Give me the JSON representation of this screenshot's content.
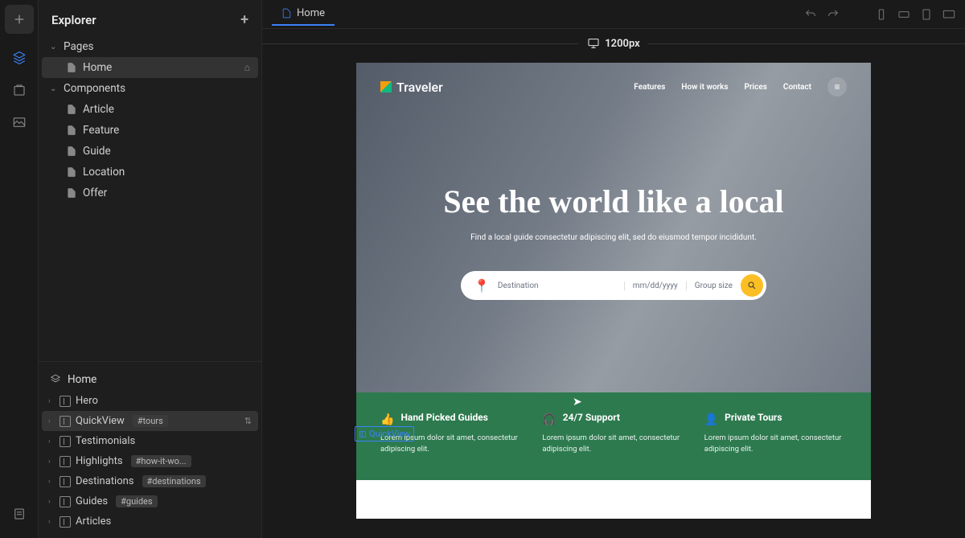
{
  "explorer": {
    "title": "Explorer",
    "sections": {
      "pages": {
        "label": "Pages",
        "items": [
          {
            "label": "Home",
            "selected": true
          }
        ]
      },
      "components": {
        "label": "Components",
        "items": [
          {
            "label": "Article"
          },
          {
            "label": "Feature"
          },
          {
            "label": "Guide"
          },
          {
            "label": "Location"
          },
          {
            "label": "Offer"
          }
        ]
      }
    }
  },
  "outline": {
    "title": "Home",
    "nodes": [
      {
        "label": "Hero"
      },
      {
        "label": "QuickView",
        "tag": "#tours",
        "selected": true,
        "reorder": true
      },
      {
        "label": "Testimonials"
      },
      {
        "label": "Highlights",
        "tag": "#how-it-wo..."
      },
      {
        "label": "Destinations",
        "tag": "#destinations"
      },
      {
        "label": "Guides",
        "tag": "#guides"
      },
      {
        "label": "Articles"
      }
    ]
  },
  "tab": {
    "label": "Home"
  },
  "viewport": {
    "label": "1200px"
  },
  "preview": {
    "brand": "Traveler",
    "nav": [
      "Features",
      "How it works",
      "Prices",
      "Contact"
    ],
    "hero": {
      "title": "See the world like a local",
      "sub": "Find a local guide consectetur adipiscing elit, sed do eiusmod tempor incididunt.",
      "search": {
        "dest": "Destination",
        "date": "mm/dd/yyyy",
        "group": "Group size"
      }
    },
    "features": [
      {
        "icon": "👍",
        "title": "Hand Picked Guides",
        "desc": "Lorem ipsum dolor sit amet, consectetur adipiscing elit."
      },
      {
        "icon": "🎧",
        "title": "24/7 Support",
        "desc": "Lorem ipsum dolor sit amet, consectetur adipiscing elit."
      },
      {
        "icon": "👤",
        "title": "Private Tours",
        "desc": "Lorem ipsum dolor sit amet, consectetur adipiscing elit."
      }
    ],
    "overlay": "QuickView"
  }
}
